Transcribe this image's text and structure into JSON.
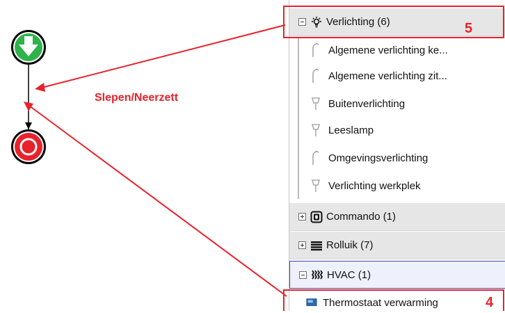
{
  "colors": {
    "annotation": "#e8212b",
    "start_node": "#2db34a",
    "end_node": "#e8212b",
    "selected_border": "#3b49a8"
  },
  "annotation": {
    "drag_label": "Slepen/Neerzett",
    "callout_5": "5",
    "callout_4": "4"
  },
  "workflow": {
    "start_icon": "arrow-down-icon",
    "end_icon": "stop-icon"
  },
  "tree": {
    "groups": [
      {
        "label": "Verlichting (6)",
        "icon": "light-bulb-icon",
        "expanded": true
      },
      {
        "label": "Commando (1)",
        "icon": "command-icon",
        "expanded": false
      },
      {
        "label": "Rolluik (7)",
        "icon": "shutter-icon",
        "expanded": false
      },
      {
        "label": "HVAC (1)",
        "icon": "hvac-icon",
        "expanded": true
      }
    ],
    "lighting_items": [
      {
        "label": "Algemene verlichting ke...",
        "icon": "floor-lamp-icon"
      },
      {
        "label": "Algemene verlichting zit...",
        "icon": "floor-lamp-icon"
      },
      {
        "label": "Buitenverlichting",
        "icon": "ceiling-lamp-icon"
      },
      {
        "label": "Leeslamp",
        "icon": "ceiling-lamp-icon"
      },
      {
        "label": "Omgevingsverlichting",
        "icon": "floor-lamp-icon"
      },
      {
        "label": "Verlichting werkplek",
        "icon": "ceiling-lamp-icon"
      }
    ],
    "hvac_items": [
      {
        "label": "Thermostaat verwarming",
        "icon": "thermostat-icon"
      }
    ]
  }
}
